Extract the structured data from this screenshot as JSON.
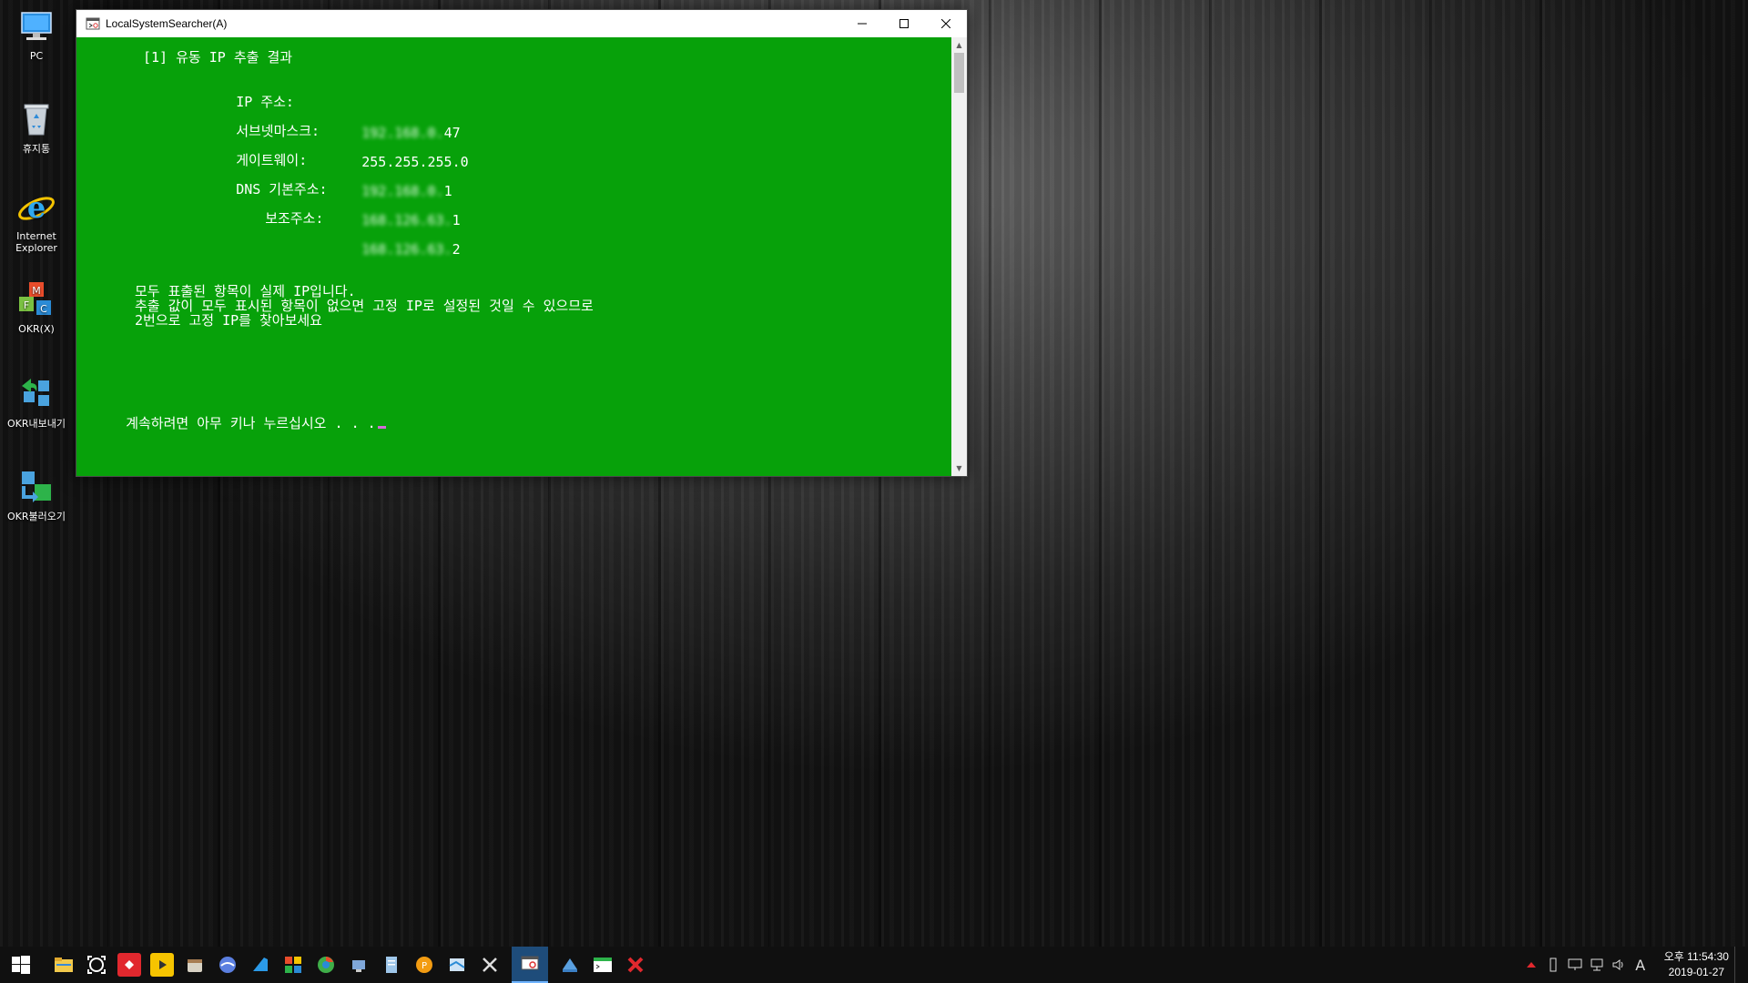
{
  "desktop": {
    "icons": [
      {
        "label": "PC"
      },
      {
        "label": "휴지통"
      },
      {
        "label": "Internet Explorer"
      },
      {
        "label": "OKR(X)"
      },
      {
        "label": "OKR내보내기"
      },
      {
        "label": "OKR불러오기"
      }
    ]
  },
  "window": {
    "title": "LocalSystemSearcher(A)",
    "controls": {
      "minimize": "—",
      "maximize": "☐",
      "close": "✕"
    }
  },
  "console": {
    "section_header": "[1] 유동 IP 추출 결과",
    "rows": [
      {
        "label": "IP 주소:",
        "value_hidden": "192.168.0.",
        "value_visible": "47"
      },
      {
        "label": "서브넷마스크:",
        "value_hidden": "",
        "value_visible": "255.255.255.0"
      },
      {
        "label": "게이트웨이:",
        "value_hidden": "192.168.0.",
        "value_visible": "1"
      },
      {
        "label": "DNS 기본주소:",
        "value_hidden": "168.126.63.",
        "value_visible": "1"
      },
      {
        "label": "보조주소:",
        "value_hidden": "168.126.63.",
        "value_visible": "2"
      }
    ],
    "notes": [
      "모두 표출된 항목이 실제 IP입니다.",
      "추출 값이 모두 표시된 항목이 없으면 고정 IP로 설정된 것일 수 있으므로",
      "2번으로 고정 IP를 찾아보세요"
    ],
    "prompt": "계속하려면 아무 키나 누르십시오 . . .",
    "background_color": "#07a10a"
  },
  "taskbar": {
    "apps": [
      {
        "icon": "windows-start-icon"
      },
      {
        "icon": "file-explorer-icon"
      },
      {
        "icon": "capture-icon"
      },
      {
        "icon": "remote-app-icon"
      },
      {
        "icon": "potplayer-icon"
      },
      {
        "icon": "archive-app-icon"
      },
      {
        "icon": "blue-orb-app-icon"
      },
      {
        "icon": "visual-studio-icon"
      },
      {
        "icon": "colorful-app-icon"
      },
      {
        "icon": "chrome-like-app-icon"
      },
      {
        "icon": "network-app-icon"
      },
      {
        "icon": "document-app-icon"
      },
      {
        "icon": "orange-circle-app-icon"
      },
      {
        "icon": "map-app-icon"
      },
      {
        "icon": "tools-app-icon"
      },
      {
        "icon": "local-system-searcher-icon"
      },
      {
        "icon": "blue-app-icon"
      },
      {
        "icon": "terminal-app-icon"
      },
      {
        "icon": "red-x-app-icon"
      }
    ],
    "tray": {
      "ime": "A",
      "time": "오후 11:54:30",
      "date": "2019-01-27"
    }
  }
}
